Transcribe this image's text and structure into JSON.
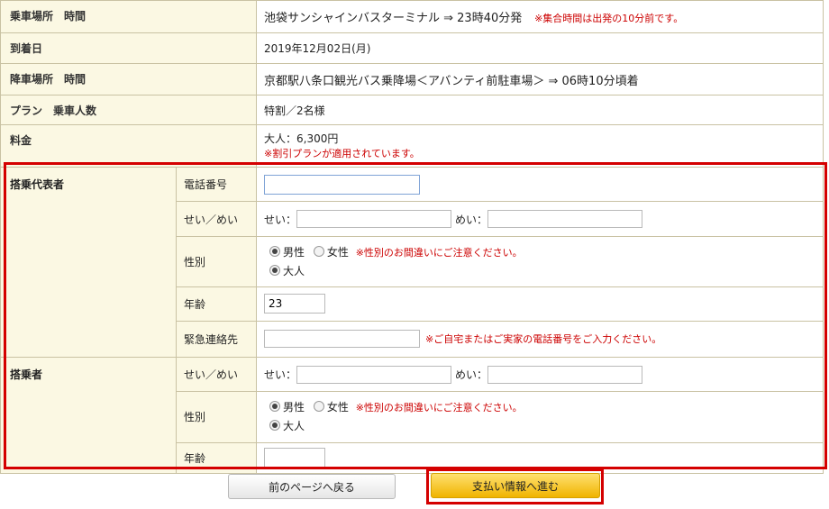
{
  "summary": {
    "boarding": {
      "label": "乗車場所　時間",
      "value": "池袋サンシャインバスターミナル ⇒ 23時40分発",
      "note": "※集合時間は出発の10分前です。"
    },
    "arrival_date": {
      "label": "到着日",
      "value": "2019年12月02日(月)"
    },
    "alighting": {
      "label": "降車場所　時間",
      "value": "京都駅八条口観光バス乗降場＜アバンティ前駐車場＞ ⇒ 06時10分頃着"
    },
    "plan": {
      "label": "プラン　乗車人数",
      "value": "特割／2名様"
    },
    "fare": {
      "label": "料金",
      "value": "大人：6,300円",
      "note": "※割引プランが適用されています。"
    }
  },
  "representative": {
    "title": "搭乗代表者",
    "phone": {
      "label": "電話番号",
      "value": ""
    },
    "name": {
      "label": "せい／めい",
      "sei_label": "せい：",
      "mei_label": "めい：",
      "sei_value": "",
      "mei_value": ""
    },
    "gender": {
      "label": "性別",
      "male": "男性",
      "female": "女性",
      "note": "※性別のお間違いにご注意ください。",
      "adult": "大人"
    },
    "age": {
      "label": "年齢",
      "value": "23"
    },
    "emergency": {
      "label": "緊急連絡先",
      "value": "",
      "note": "※ご自宅またはご実家の電話番号をご入力ください。"
    }
  },
  "passenger": {
    "title": "搭乗者",
    "name": {
      "label": "せい／めい",
      "sei_label": "せい：",
      "mei_label": "めい：",
      "sei_value": "",
      "mei_value": ""
    },
    "gender": {
      "label": "性別",
      "male": "男性",
      "female": "女性",
      "note": "※性別のお間違いにご注意ください。",
      "adult": "大人"
    },
    "age": {
      "label": "年齢",
      "value": ""
    }
  },
  "buttons": {
    "back": "前のページへ戻る",
    "next": "支払い情報へ進む"
  },
  "colors": {
    "highlight": "#d40000",
    "header_bg": "#fbf8e3",
    "next_button": "#f0b400"
  }
}
